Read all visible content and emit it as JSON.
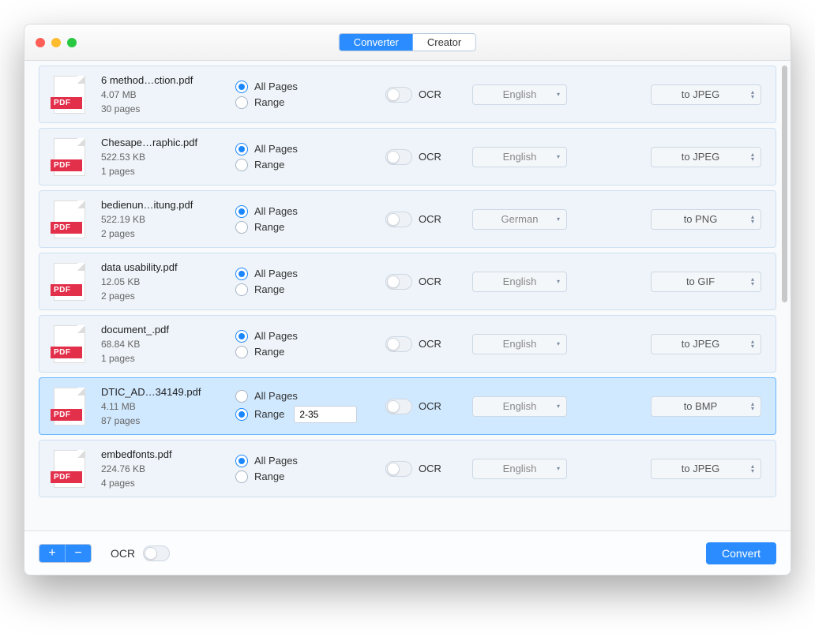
{
  "tabs": {
    "converter": "Converter",
    "creator": "Creator",
    "active": "converter"
  },
  "labels": {
    "all_pages": "All Pages",
    "range": "Range",
    "ocr": "OCR",
    "pdf_badge": "PDF",
    "convert": "Convert",
    "add": "+",
    "remove": "−"
  },
  "footer": {
    "ocr_label": "OCR"
  },
  "files": [
    {
      "name": "6 method…ction.pdf",
      "size": "4.07 MB",
      "pages": "30 pages",
      "mode": "all",
      "range_value": "",
      "lang": "English",
      "format": "to JPEG",
      "selected": false
    },
    {
      "name": "Chesape…raphic.pdf",
      "size": "522.53 KB",
      "pages": "1 pages",
      "mode": "all",
      "range_value": "",
      "lang": "English",
      "format": "to JPEG",
      "selected": false
    },
    {
      "name": "bedienun…itung.pdf",
      "size": "522.19 KB",
      "pages": "2 pages",
      "mode": "all",
      "range_value": "",
      "lang": "German",
      "format": "to PNG",
      "selected": false
    },
    {
      "name": "data usability.pdf",
      "size": "12.05 KB",
      "pages": "2 pages",
      "mode": "all",
      "range_value": "",
      "lang": "English",
      "format": "to GIF",
      "selected": false
    },
    {
      "name": "document_.pdf",
      "size": "68.84 KB",
      "pages": "1 pages",
      "mode": "all",
      "range_value": "",
      "lang": "English",
      "format": "to JPEG",
      "selected": false
    },
    {
      "name": "DTIC_AD…34149.pdf",
      "size": "4.11 MB",
      "pages": "87 pages",
      "mode": "range",
      "range_value": "2-35",
      "lang": "English",
      "format": "to BMP",
      "selected": true
    },
    {
      "name": "embedfonts.pdf",
      "size": "224.76 KB",
      "pages": "4 pages",
      "mode": "all",
      "range_value": "",
      "lang": "English",
      "format": "to JPEG",
      "selected": false
    }
  ]
}
